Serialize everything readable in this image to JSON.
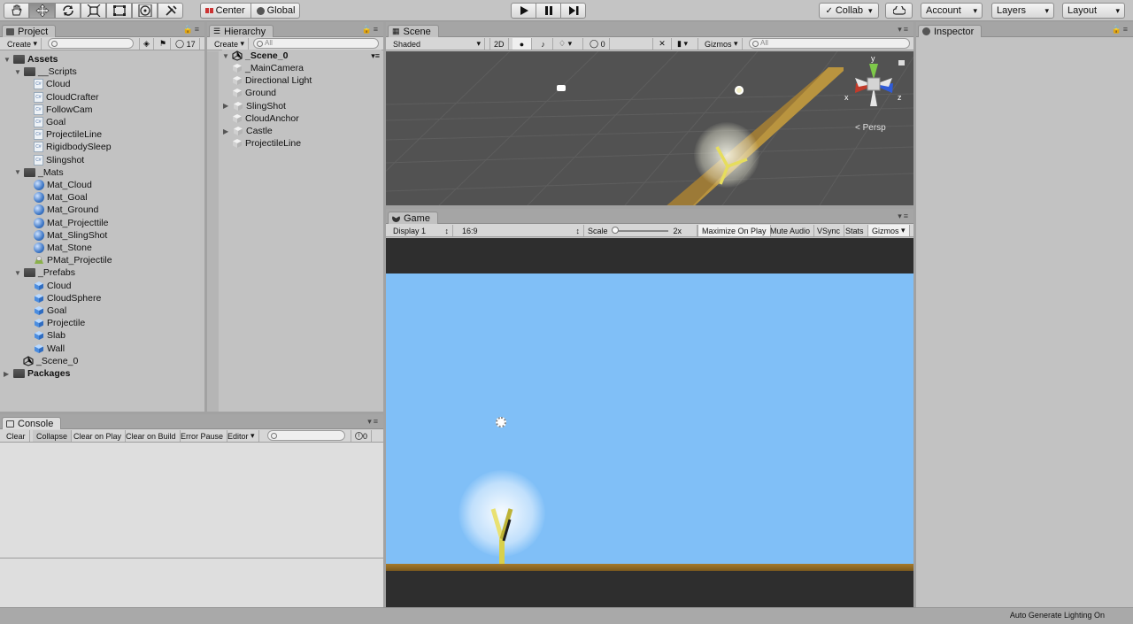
{
  "toolbar": {
    "tools": [
      "hand-tool-icon",
      "move-tool-icon",
      "rotate-tool-icon",
      "scale-tool-icon",
      "rect-tool-icon",
      "transform-tool-icon",
      "custom-tool-icon"
    ],
    "pivot": "Center",
    "space": "Global",
    "collab": "Collab",
    "account": "Account",
    "layers": "Layers",
    "layout": "Layout"
  },
  "project": {
    "tab": "Project",
    "create": "Create",
    "hidden_count": "17",
    "items": [
      {
        "label": "Assets",
        "kind": "folder",
        "bold": true
      },
      {
        "label": "__Scripts",
        "kind": "folder"
      },
      {
        "label": "Cloud",
        "kind": "script"
      },
      {
        "label": "CloudCrafter",
        "kind": "script"
      },
      {
        "label": "FollowCam",
        "kind": "script"
      },
      {
        "label": "Goal",
        "kind": "script"
      },
      {
        "label": "ProjectileLine",
        "kind": "script"
      },
      {
        "label": "RigidbodySleep",
        "kind": "script"
      },
      {
        "label": "Slingshot",
        "kind": "script"
      },
      {
        "label": "_Mats",
        "kind": "folder"
      },
      {
        "label": "Mat_Cloud",
        "kind": "material"
      },
      {
        "label": "Mat_Goal",
        "kind": "material"
      },
      {
        "label": "Mat_Ground",
        "kind": "material"
      },
      {
        "label": "Mat_Projecttile",
        "kind": "material"
      },
      {
        "label": "Mat_SlingShot",
        "kind": "material"
      },
      {
        "label": "Mat_Stone",
        "kind": "material"
      },
      {
        "label": "PMat_Projectile",
        "kind": "physic-material"
      },
      {
        "label": "_Prefabs",
        "kind": "folder"
      },
      {
        "label": "Cloud",
        "kind": "prefab"
      },
      {
        "label": "CloudSphere",
        "kind": "prefab"
      },
      {
        "label": "Goal",
        "kind": "prefab"
      },
      {
        "label": "Projectile",
        "kind": "prefab"
      },
      {
        "label": "Slab",
        "kind": "prefab"
      },
      {
        "label": "Wall",
        "kind": "prefab"
      },
      {
        "label": "_Scene_0",
        "kind": "scene"
      },
      {
        "label": "Packages",
        "kind": "folder",
        "bold": true
      }
    ]
  },
  "hierarchy": {
    "tab": "Hierarchy",
    "create": "Create",
    "search_placeholder": "All",
    "scene": "_Scene_0",
    "items": [
      "_MainCamera",
      "Directional Light",
      "Ground",
      "SlingShot",
      "CloudAnchor",
      "Castle",
      "ProjectileLine"
    ]
  },
  "scene": {
    "tab": "Scene",
    "shading": "Shaded",
    "mode2d": "2D",
    "hidden_count": "0",
    "gizmos": "Gizmos",
    "search_placeholder": "All",
    "persp": "Persp",
    "axis_y": "y",
    "axis_x": "x",
    "axis_z": "z"
  },
  "game": {
    "tab": "Game",
    "display": "Display 1",
    "aspect": "16:9",
    "scale_label": "Scale",
    "scale_value": "2x",
    "maximize": "Maximize On Play",
    "mute": "Mute Audio",
    "vsync": "VSync",
    "stats": "Stats",
    "gizmos": "Gizmos",
    "sky_color": "#80bff7",
    "ground_color": "#8a6423"
  },
  "console": {
    "tab": "Console",
    "buttons": [
      "Clear",
      "Collapse",
      "Clear on Play",
      "Clear on Build",
      "Error Pause",
      "Editor"
    ],
    "count": "0"
  },
  "inspector": {
    "tab": "Inspector"
  },
  "status": {
    "text": "Auto Generate Lighting On"
  }
}
